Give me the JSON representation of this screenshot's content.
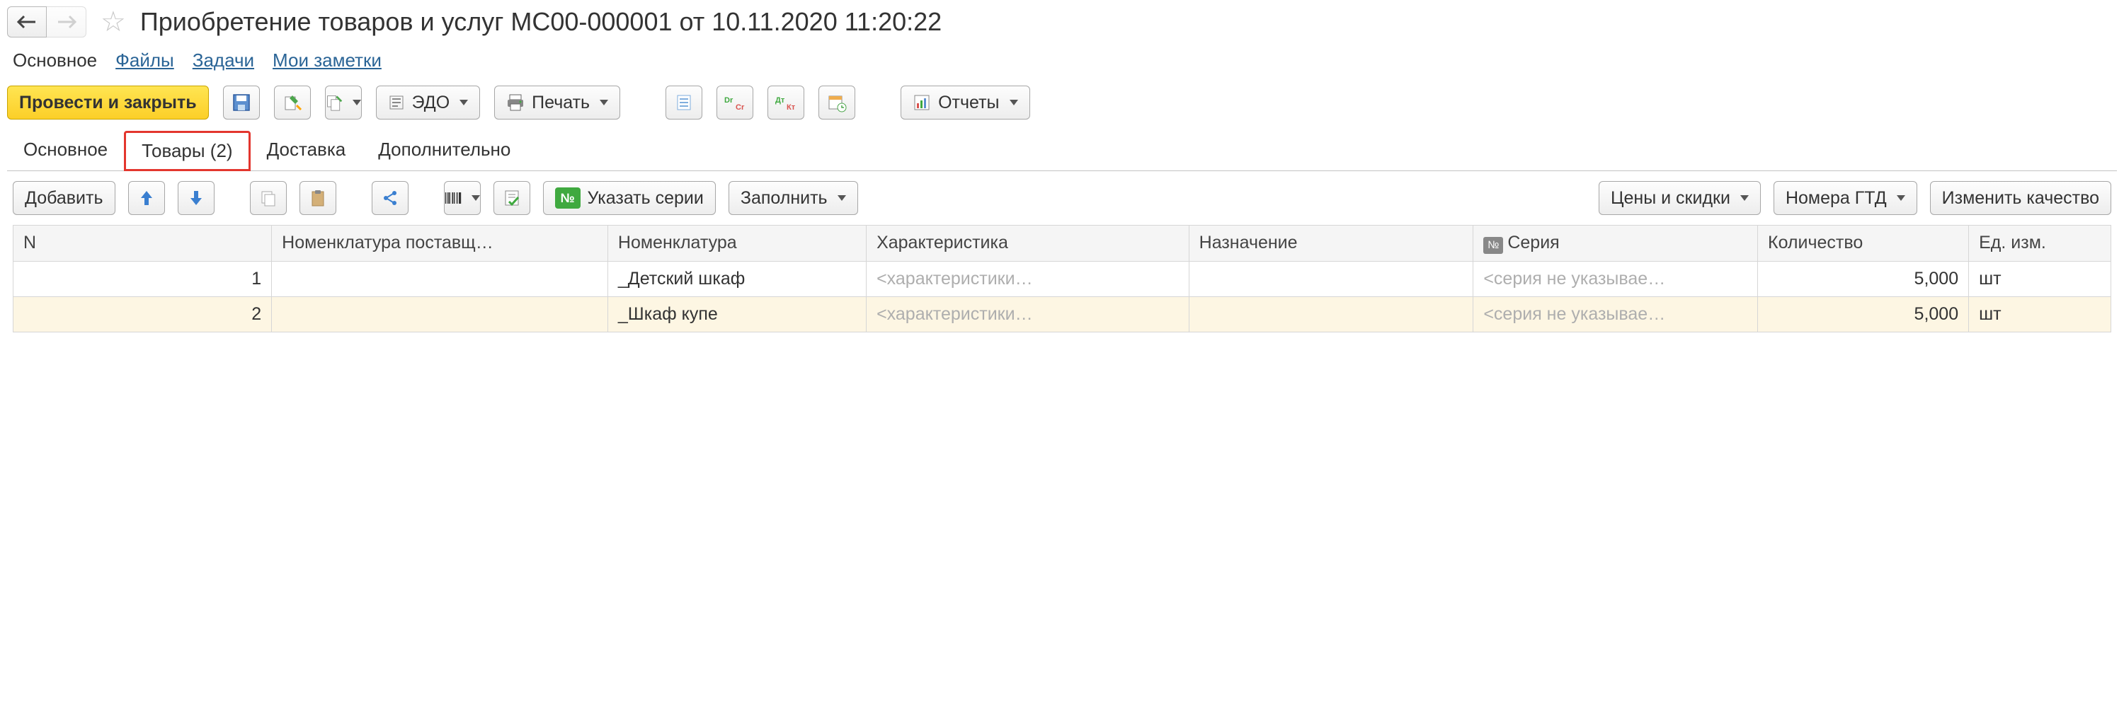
{
  "header": {
    "title": "Приобретение товаров и услуг МС00-000001 от 10.11.2020 11:20:22"
  },
  "nav_tabs": {
    "main": "Основное",
    "files": "Файлы",
    "tasks": "Задачи",
    "notes": "Мои заметки"
  },
  "toolbar": {
    "save_close": "Провести и закрыть",
    "edo": "ЭДО",
    "print": "Печать",
    "reports": "Отчеты"
  },
  "subtabs": {
    "main": "Основное",
    "goods": "Товары (2)",
    "delivery": "Доставка",
    "additional": "Дополнительно"
  },
  "table_toolbar": {
    "add": "Добавить",
    "series": "Указать серии",
    "fill": "Заполнить",
    "prices": "Цены и скидки",
    "gtd": "Номера ГТД",
    "quality": "Изменить качество"
  },
  "table": {
    "headers": {
      "n": "N",
      "supplier_nom": "Номенклатура поставщ…",
      "nom": "Номенклатура",
      "char": "Характеристика",
      "purpose": "Назначение",
      "series": "Серия",
      "qty": "Количество",
      "unit": "Ед. изм."
    },
    "badge_no": "№",
    "rows": [
      {
        "n": "1",
        "supplier_nom": "",
        "nom": "_Детский шкаф",
        "char": "<характеристики…",
        "purpose": "",
        "series": "<серия не указывае…",
        "qty": "5,000",
        "unit": "шт"
      },
      {
        "n": "2",
        "supplier_nom": "",
        "nom": "_Шкаф купе",
        "char": "<характеристики…",
        "purpose": "",
        "series": "<серия не указывае…",
        "qty": "5,000",
        "unit": "шт"
      }
    ]
  }
}
